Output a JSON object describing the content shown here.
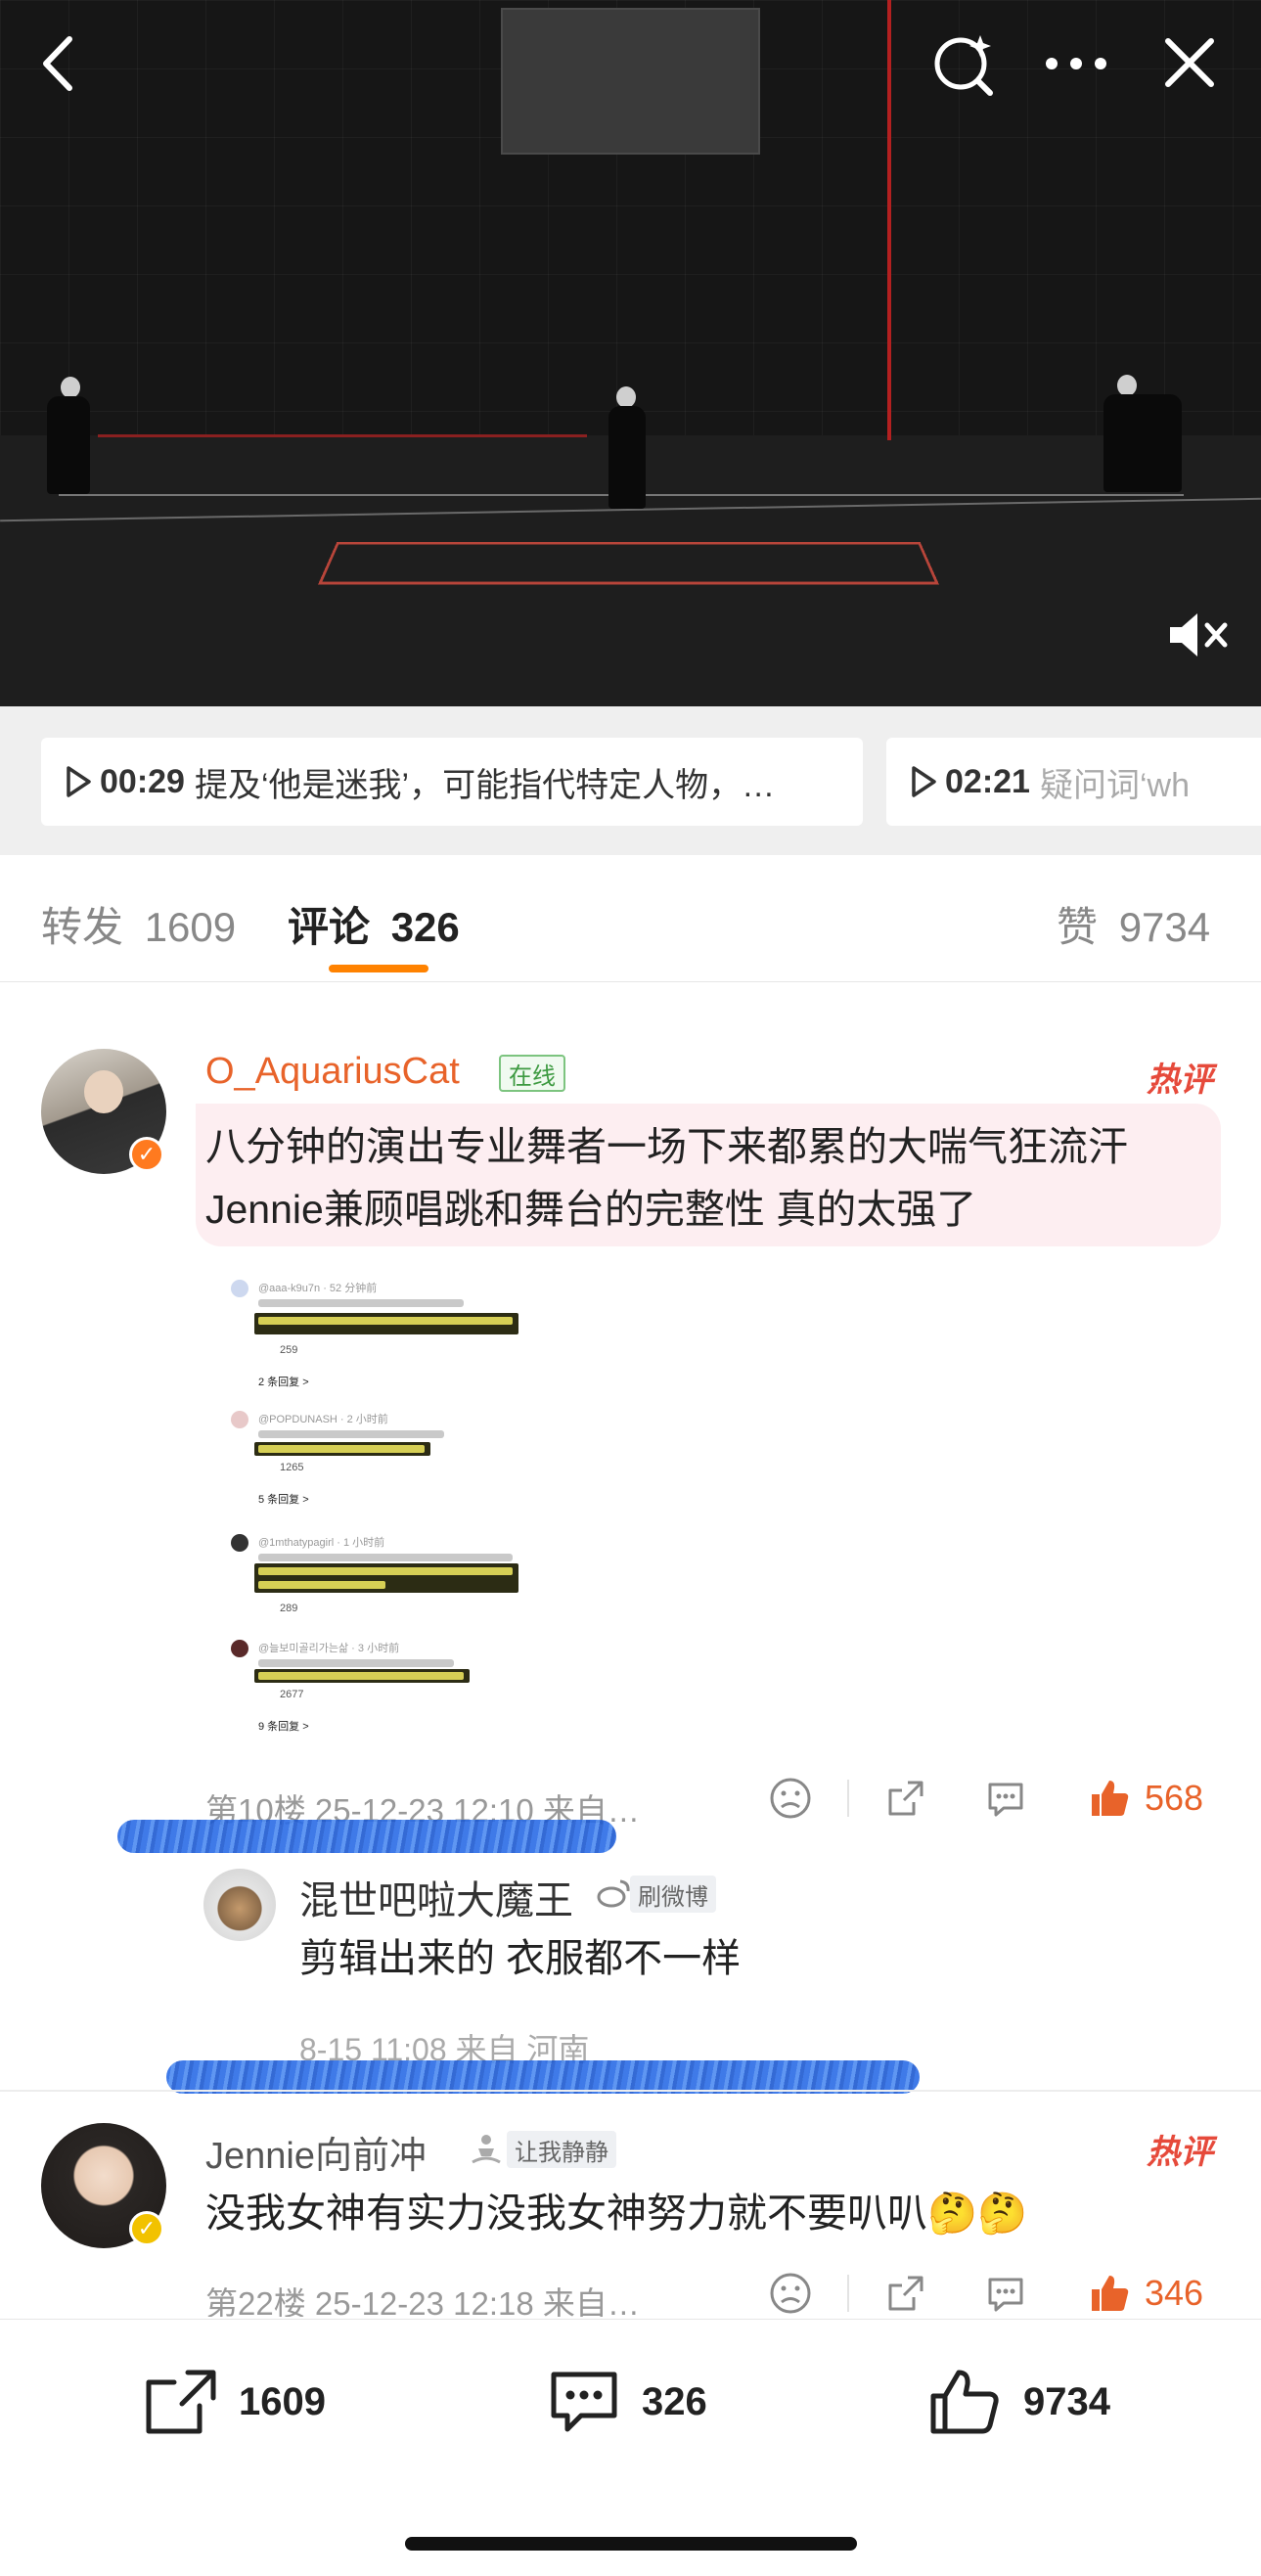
{
  "video": {
    "mute_icon": "volume-mute-icon",
    "back_icon": "chevron-left-icon",
    "search_icon": "sparkle-search-icon",
    "more_icon": "more-dots-icon",
    "close_icon": "close-icon"
  },
  "chapters": [
    {
      "time": "00:29",
      "text": "提及‘他是迷我’，可能指代特定人物，…"
    },
    {
      "time": "02:21",
      "text": "疑问词‘wh"
    }
  ],
  "tabs": {
    "repost": {
      "label": "转发",
      "count": "1609"
    },
    "comments": {
      "label": "评论",
      "count": "326"
    },
    "likes": {
      "label": "赞",
      "count": "9734"
    }
  },
  "comments": [
    {
      "username": "O_AquariusCat",
      "status_tag": "在线",
      "hot_label": "热评",
      "text": "八分钟的演出专业舞者一场下来都累的大喘气狂流汗 Jennie兼顾唱跳和舞台的完整性 真的太强了",
      "meta": "第10楼 25-12-23 12:10 来自…",
      "likes": "568",
      "screenshot": {
        "entries": [
          {
            "user": "@aaa-k9u7n · 52 分钟前",
            "likes": "259",
            "replies": "2 条回复 >"
          },
          {
            "user": "@POPDUNASH · 2 小时前",
            "likes": "1265",
            "replies": "5 条回复 >"
          },
          {
            "user": "@1mthatypagirl · 1 小时前",
            "likes": "289",
            "replies": ""
          },
          {
            "user": "@늘보미골리가는삶 · 3 小时前",
            "likes": "2677",
            "replies": "9 条回复 >"
          }
        ]
      },
      "reply": {
        "username": "混世吧啦大魔王",
        "tag": "刷微博",
        "text": "剪辑出来的  衣服都不一样",
        "meta": "8-15 11:08 来自 河南"
      }
    },
    {
      "username": "Jennie向前冲",
      "status_tag": "让我静静",
      "hot_label": "热评",
      "text": "没我女神有实力没我女神努力就不要叭叭🤔🤔",
      "meta": "第22楼 25-12-23 12:18 来自…",
      "likes": "346"
    }
  ],
  "bottom_bar": {
    "repost_count": "1609",
    "comment_count": "326",
    "like_count": "9734"
  },
  "colors": {
    "accent": "#ff8200",
    "like_orange": "#e8632a",
    "username_orange": "#e8632a",
    "hot_red": "#e64a3b",
    "online_green": "#4caf50"
  }
}
